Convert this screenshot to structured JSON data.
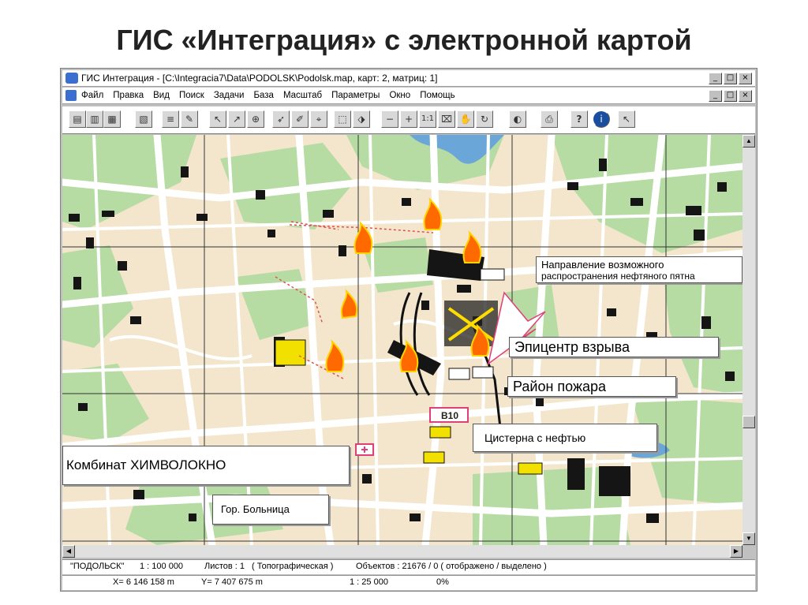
{
  "slide": {
    "title": "ГИС «Интеграция» с электронной картой"
  },
  "window": {
    "title": "ГИС Интеграция - [C:\\Integracia7\\Data\\PODOLSK\\Podolsk.map, карт: 2, матриц: 1]"
  },
  "menu": [
    "Файл",
    "Правка",
    "Вид",
    "Поиск",
    "Задачи",
    "База",
    "Масштаб",
    "Параметры",
    "Окно",
    "Помощь"
  ],
  "map_labels": {
    "direction_line1": "Направление возможного",
    "direction_line2": "распространения нефтяного пятна",
    "epicenter": "Эпицентр взрыва",
    "fire_area": "Район пожара",
    "tank": "Цистерна с нефтью",
    "plant": "Комбинат ХИМВОЛОКНО",
    "hospital": "Гор. Больница",
    "marker": "В10"
  },
  "status": {
    "map_name": "\"ПОДОЛЬСК\"",
    "scale": "1 : 100 000",
    "sheets": "Листов : 1",
    "map_type": "( Топографическая )",
    "objects": "Объектов : 21676 / 0 ( отображено / выделено )",
    "x_coord": "X= 6 146 158 m",
    "y_coord": "Y= 7 407 675 m",
    "view_scale": "1 : 25 000",
    "progress": "0%"
  },
  "colors": {
    "map_background": "#f3e6cc",
    "greenery": "#b6dca4",
    "roads": "#ffffff",
    "water": "#6aa6d8",
    "buildings": "#111111",
    "fire": "#ff6a00",
    "callout_border": "#555555",
    "accent_pink": "#e0407a"
  }
}
